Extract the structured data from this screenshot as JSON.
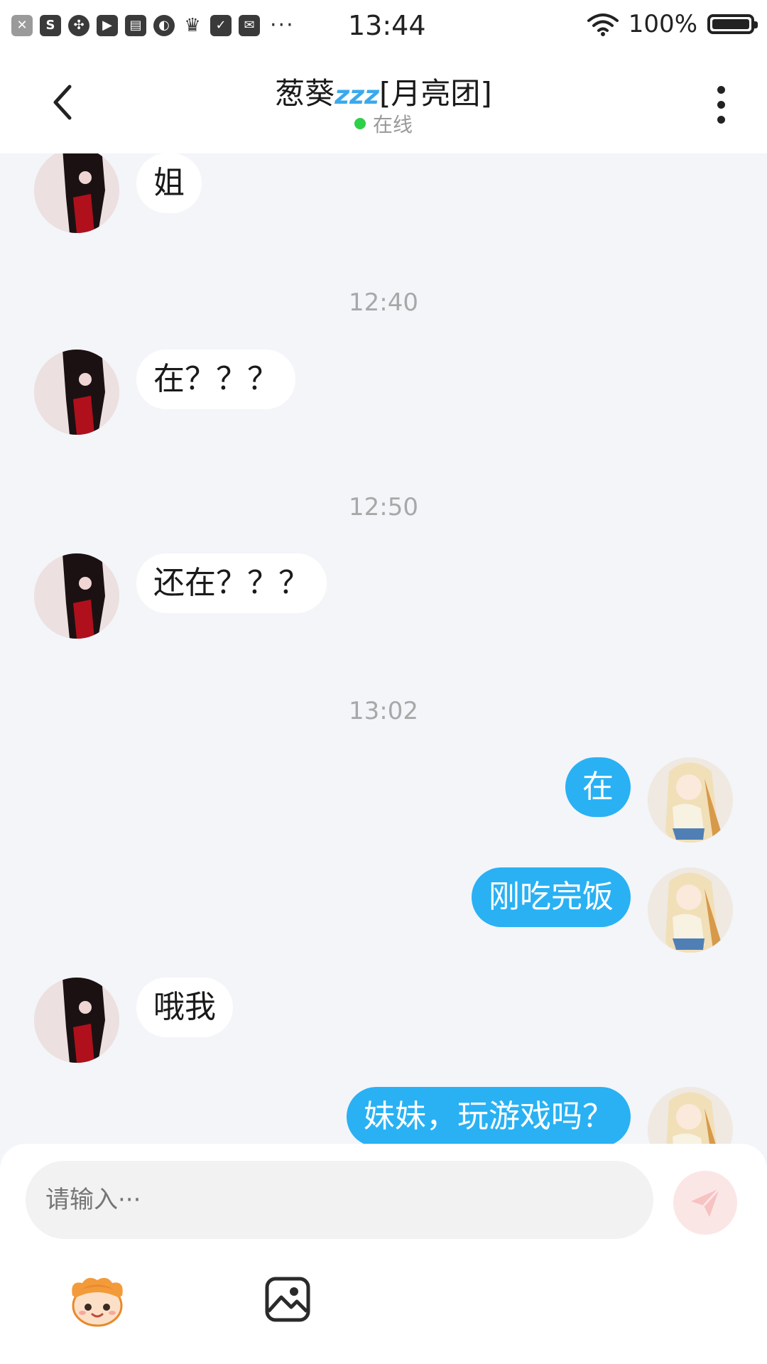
{
  "status_bar": {
    "time": "13:44",
    "battery": "100%",
    "left_icons": [
      "close-box-icon",
      "s-icon",
      "pinwheel-icon",
      "play-icon",
      "calendar-icon",
      "planet-icon",
      "crown-icon",
      "clipboard-check-icon",
      "mail-icon"
    ],
    "overflow": "···"
  },
  "header": {
    "name": "葱葵",
    "emoji": "zzz",
    "group_tag": "[月亮团]",
    "status": "在线",
    "online_color": "#2fcf4a"
  },
  "messages": [
    {
      "side": "in",
      "text": "姐"
    },
    {
      "time": "12:40"
    },
    {
      "side": "in",
      "text": "在？？？"
    },
    {
      "time": "12:50"
    },
    {
      "side": "in",
      "text": "还在？？？"
    },
    {
      "time": "13:02"
    },
    {
      "side": "out",
      "text": "在"
    },
    {
      "side": "out",
      "text": "刚吃完饭"
    },
    {
      "side": "in",
      "text": "哦我"
    },
    {
      "side": "out",
      "text": "妹妹，玩游戏吗？"
    }
  ],
  "colors": {
    "outgoing_bubble": "#29b1f4",
    "incoming_bubble": "#ffffff",
    "chat_background": "#f3f5f9",
    "send_button": "#fbe6e6"
  },
  "composer": {
    "placeholder": "请输入···",
    "icons": [
      "emoji-mascot-icon",
      "image-icon",
      "send-plane-icon"
    ]
  }
}
